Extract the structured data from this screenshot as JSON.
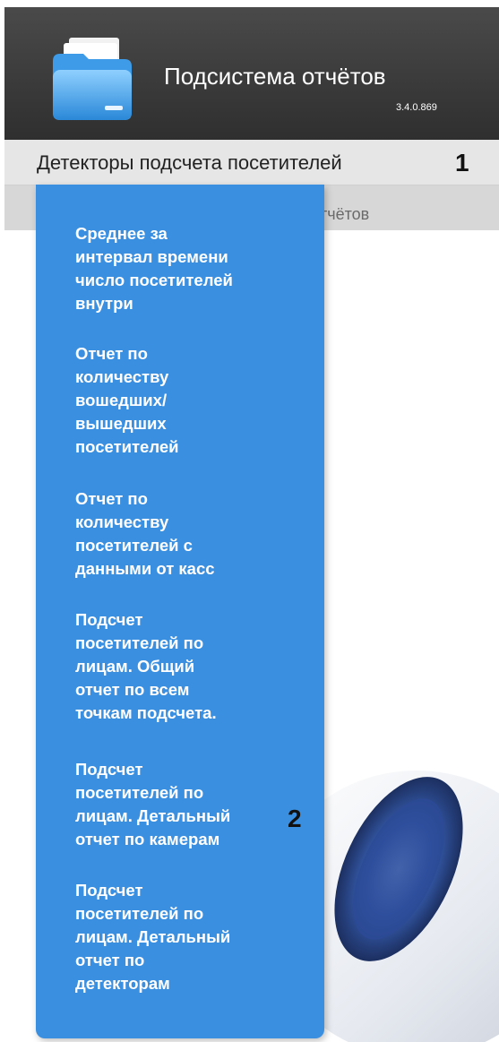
{
  "header": {
    "title": "Подсистема отчётов",
    "version": "3.4.0.869",
    "icon": "folder-icon"
  },
  "menu": {
    "category_label": "Детекторы подсчета посетителей",
    "marker": "1"
  },
  "subbar": {
    "text": "тчётов"
  },
  "dropdown": {
    "items": [
      {
        "label": "Среднее за\nинтервал времени\nчисло посетителей\nвнутри"
      },
      {
        "label": "Отчет по\nколичеству\nвошедших/\nвышедших\nпосетителей"
      },
      {
        "label": "Отчет по\nколичеству\nпосетителей с\nданными от касс"
      },
      {
        "label": "Подсчет\nпосетителей по\nлицам. Общий\nотчет по всем\nточкам подсчета."
      },
      {
        "label": "Подсчет\nпосетителей по\nлицам. Детальный\nотчет по камерам"
      },
      {
        "label": "Подсчет\nпосетителей по\nлицам. Детальный\nотчет по\nдетекторам"
      }
    ],
    "marker": "2"
  },
  "colors": {
    "header_bg": "#3a3a3a",
    "dropdown_bg": "#3b8fe0",
    "menu_bg": "#e6e6e6"
  }
}
